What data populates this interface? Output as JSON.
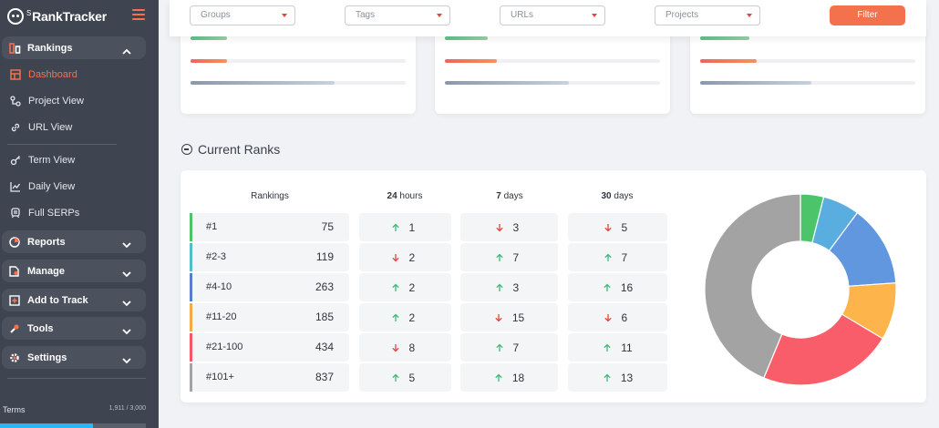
{
  "brand": {
    "small": "S",
    "name": "RankTracker"
  },
  "sidebar": {
    "rankings_group": "Rankings",
    "items": [
      {
        "label": "Dashboard",
        "icon": "dashboard-icon"
      },
      {
        "label": "Project View",
        "icon": "project-view-icon"
      },
      {
        "label": "URL View",
        "icon": "link-icon"
      },
      {
        "label": "Term View",
        "icon": "key-icon"
      },
      {
        "label": "Daily View",
        "icon": "line-chart-icon"
      },
      {
        "label": "Full SERPs",
        "icon": "serps-icon"
      }
    ],
    "groups": [
      {
        "label": "Reports",
        "icon": "clock-report-icon"
      },
      {
        "label": "Manage",
        "icon": "manage-icon"
      },
      {
        "label": "Add to Track",
        "icon": "plus-square-icon"
      },
      {
        "label": "Tools",
        "icon": "tools-icon"
      },
      {
        "label": "Settings",
        "icon": "gear-icon"
      }
    ],
    "terms_label": "Terms",
    "terms_count": "1,911 / 3,000",
    "terms_fraction": 0.637
  },
  "filters": {
    "groups": "Groups",
    "tags": "Tags",
    "urls": "URLs",
    "projects": "Projects",
    "button": "Filter"
  },
  "section_title": "Current Ranks",
  "table": {
    "headers": {
      "rankings": "Rankings",
      "h24_num": "24",
      "h24_unit": " hours",
      "d7_num": "7",
      "d7_unit": " days",
      "d30_num": "30",
      "d30_unit": " days"
    },
    "rows": [
      {
        "label": "#1",
        "value": "75",
        "color": "#4cc46a",
        "h24": {
          "dir": "up",
          "v": "1"
        },
        "d7": {
          "dir": "down",
          "v": "3"
        },
        "d30": {
          "dir": "down",
          "v": "5"
        }
      },
      {
        "label": "#2-3",
        "value": "119",
        "color": "#4cc0c4",
        "h24": {
          "dir": "down",
          "v": "2"
        },
        "d7": {
          "dir": "up",
          "v": "7"
        },
        "d30": {
          "dir": "up",
          "v": "7"
        }
      },
      {
        "label": "#4-10",
        "value": "263",
        "color": "#5b7ad0",
        "h24": {
          "dir": "up",
          "v": "2"
        },
        "d7": {
          "dir": "up",
          "v": "3"
        },
        "d30": {
          "dir": "up",
          "v": "16"
        }
      },
      {
        "label": "#11-20",
        "value": "185",
        "color": "#f5a94b",
        "h24": {
          "dir": "up",
          "v": "2"
        },
        "d7": {
          "dir": "down",
          "v": "15"
        },
        "d30": {
          "dir": "down",
          "v": "6"
        }
      },
      {
        "label": "#21-100",
        "value": "434",
        "color": "#f25a68",
        "h24": {
          "dir": "down",
          "v": "8"
        },
        "d7": {
          "dir": "up",
          "v": "7"
        },
        "d30": {
          "dir": "up",
          "v": "11"
        }
      },
      {
        "label": "#101+",
        "value": "837",
        "color": "#a3a3a3",
        "h24": {
          "dir": "up",
          "v": "5"
        },
        "d7": {
          "dir": "up",
          "v": "18"
        },
        "d30": {
          "dir": "up",
          "v": "13"
        }
      }
    ]
  },
  "colors": {
    "accent": "#f4714d",
    "up": "#3cb878",
    "down": "#e2443b"
  },
  "donut_colors": [
    "#4cc46a",
    "#5aaedf",
    "#6197de",
    "#fdb44b",
    "#f95d6a",
    "#a3a3a3"
  ]
}
